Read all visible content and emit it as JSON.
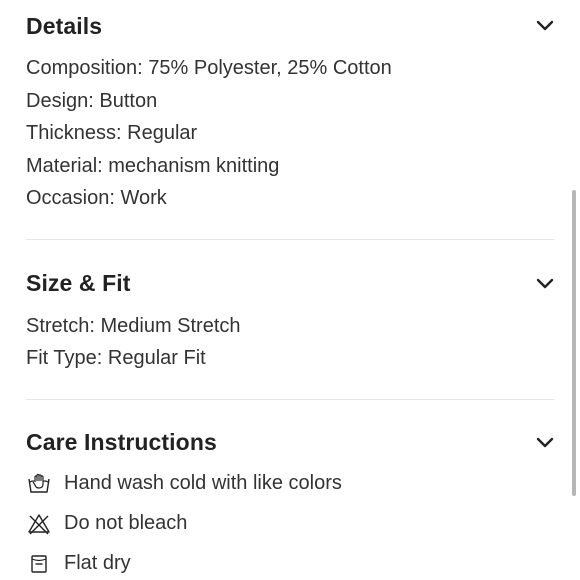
{
  "details": {
    "title": "Details",
    "items": [
      "Composition: 75% Polyester, 25% Cotton",
      "Design: Button",
      "Thickness: Regular",
      "Material: mechanism knitting",
      "Occasion: Work"
    ]
  },
  "size_fit": {
    "title": "Size & Fit",
    "items": [
      "Stretch: Medium Stretch",
      "Fit Type: Regular Fit"
    ]
  },
  "care": {
    "title": "Care Instructions",
    "items": [
      {
        "icon": "hand-wash-icon",
        "label": "Hand wash cold with like colors"
      },
      {
        "icon": "do-not-bleach-icon",
        "label": "Do not bleach"
      },
      {
        "icon": "flat-dry-icon",
        "label": "Flat dry"
      }
    ]
  },
  "colors": {
    "text": "#222222",
    "divider": "#e6e6e6",
    "scrollbar": "#9e9e9e"
  }
}
